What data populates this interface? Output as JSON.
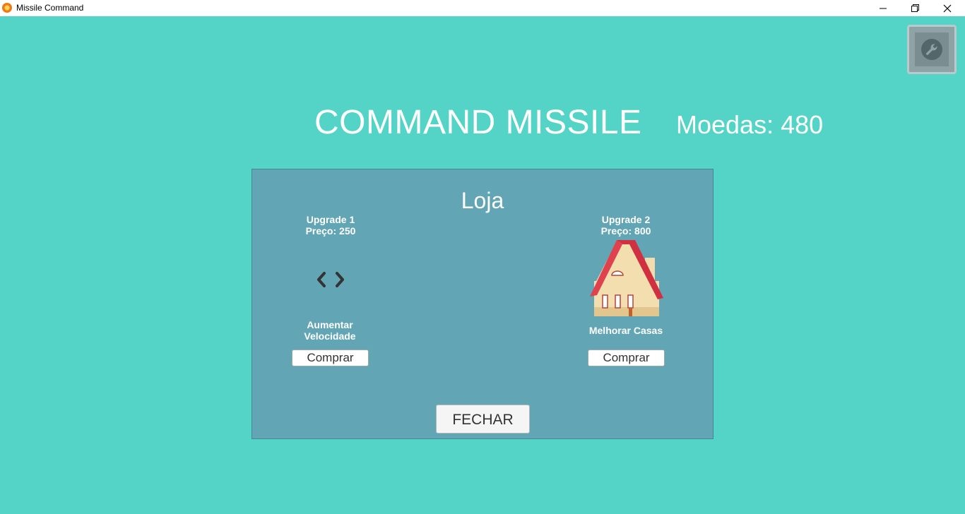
{
  "window": {
    "title": "Missile Command",
    "icon": "app-flame-icon",
    "controls": [
      "minimize-icon",
      "maximize-icon",
      "close-icon"
    ]
  },
  "settings": {
    "icon": "wrench-icon"
  },
  "header": {
    "title": "COMMAND MISSILE",
    "coins_label": "Moedas:",
    "coins_value": "480"
  },
  "shop": {
    "title": "Loja",
    "upgrades": [
      {
        "name": "Upgrade 1",
        "price": "Preço: 250",
        "icon": "chevrons-icon",
        "description_line1": "Aumentar",
        "description_line2": "Velocidade",
        "buy_label": "Comprar"
      },
      {
        "name": "Upgrade 2",
        "price": "Preço: 800",
        "icon": "house-icon",
        "description_line1": "Melhorar Casas",
        "buy_label": "Comprar"
      }
    ],
    "close_label": "FECHAR"
  },
  "colors": {
    "background": "#54d4c7",
    "panel": "#62a5b5",
    "house_roof": "#d0303f"
  }
}
